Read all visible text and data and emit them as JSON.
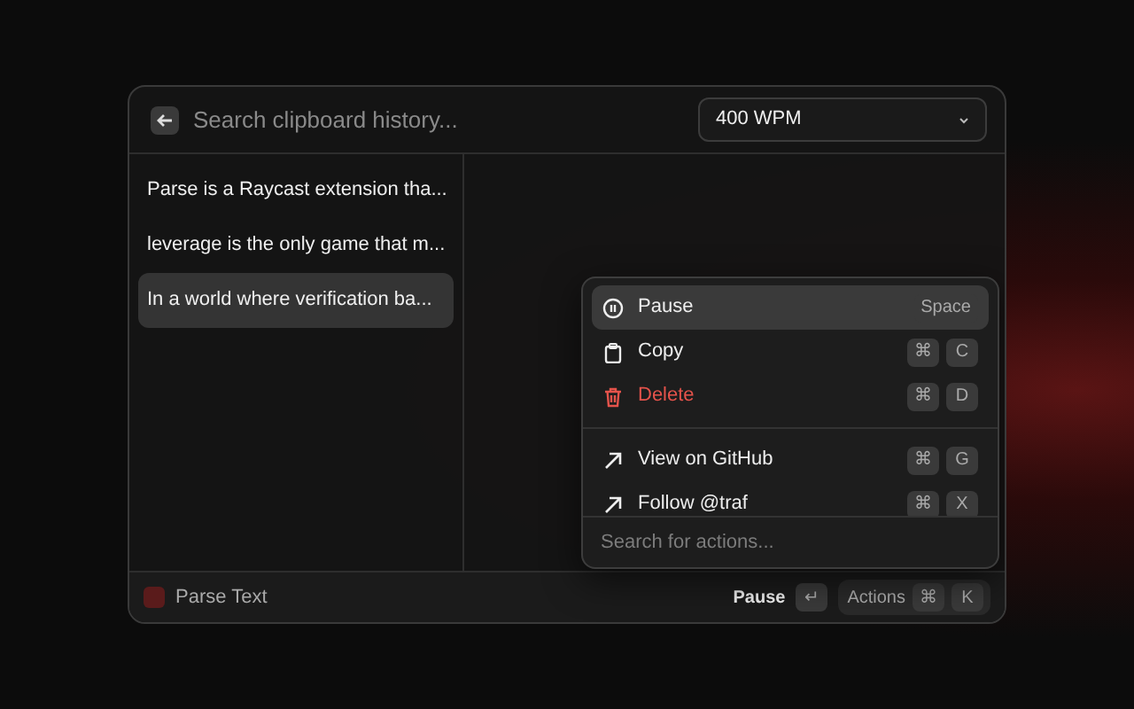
{
  "search": {
    "placeholder": "Search clipboard history..."
  },
  "speed_dropdown": {
    "value": "400 WPM"
  },
  "history": [
    {
      "text": "Parse is a Raycast extension tha...",
      "selected": false
    },
    {
      "text": "leverage is the only game that m...",
      "selected": false
    },
    {
      "text": "In a world where verification ba...",
      "selected": true
    }
  ],
  "actions_menu": {
    "sections": [
      [
        {
          "label": "Pause",
          "kind": "pause",
          "selected": true,
          "keys": [
            "Space"
          ]
        },
        {
          "label": "Copy",
          "kind": "copy",
          "selected": false,
          "keys": [
            "⌘",
            "C"
          ]
        },
        {
          "label": "Delete",
          "kind": "delete",
          "selected": false,
          "keys": [
            "⌘",
            "D"
          ]
        }
      ],
      [
        {
          "label": "View on GitHub",
          "kind": "link",
          "selected": false,
          "keys": [
            "⌘",
            "G"
          ]
        },
        {
          "label": "Follow @traf",
          "kind": "link",
          "selected": false,
          "keys": [
            "⌘",
            "X"
          ]
        }
      ]
    ],
    "search_placeholder": "Search for actions..."
  },
  "footer": {
    "title": "Parse Text",
    "primary_action": "Pause",
    "primary_key": "↵",
    "actions_label": "Actions",
    "actions_keys": [
      "⌘",
      "K"
    ]
  }
}
